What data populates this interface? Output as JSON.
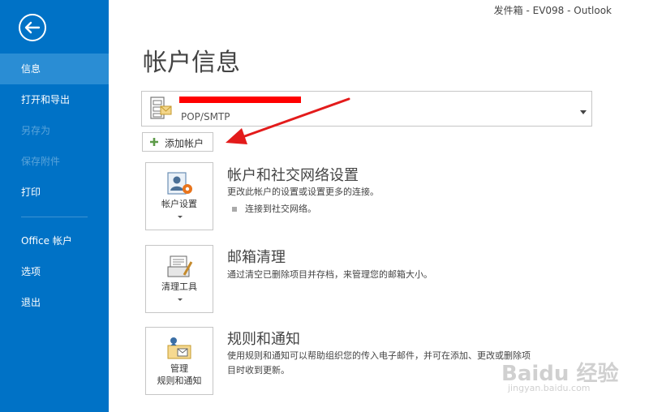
{
  "window": {
    "title": "发件箱 - EV098 - Outlook"
  },
  "sidebar": {
    "items": [
      {
        "label": "信息",
        "state": "selected"
      },
      {
        "label": "打开和导出",
        "state": "normal"
      },
      {
        "label": "另存为",
        "state": "disabled"
      },
      {
        "label": "保存附件",
        "state": "disabled"
      },
      {
        "label": "打印",
        "state": "normal"
      },
      {
        "label": "Office 帐户",
        "state": "normal"
      },
      {
        "label": "选项",
        "state": "normal"
      },
      {
        "label": "退出",
        "state": "normal"
      }
    ]
  },
  "main": {
    "title": "帐户信息",
    "account_selector": {
      "type": "POP/SMTP"
    },
    "add_account_label": "添加帐户",
    "sections": [
      {
        "tile_label": "帐户设置",
        "title": "帐户和社交网络设置",
        "description": "更改此帐户的设置或设置更多的连接。",
        "bullet": "连接到社交网络。"
      },
      {
        "tile_label": "清理工具",
        "title": "邮箱清理",
        "description": "通过清空已删除项目并存档，来管理您的邮箱大小。"
      },
      {
        "tile_label_line1": "管理",
        "tile_label_line2": "规则和通知",
        "title": "规则和通知",
        "description_line1": "使用规则和通知可以帮助组织您的传入电子邮件，并可在添加、更改或删除项",
        "description_line2": "目时收到更新。"
      }
    ]
  },
  "watermark": {
    "text": "Baidu 经验",
    "url": "jingyan.baidu.com"
  },
  "colors": {
    "sidebar": "#0072c6",
    "sidebar_selected": "#2a8dd4",
    "annotation_arrow": "#e31b1b"
  }
}
